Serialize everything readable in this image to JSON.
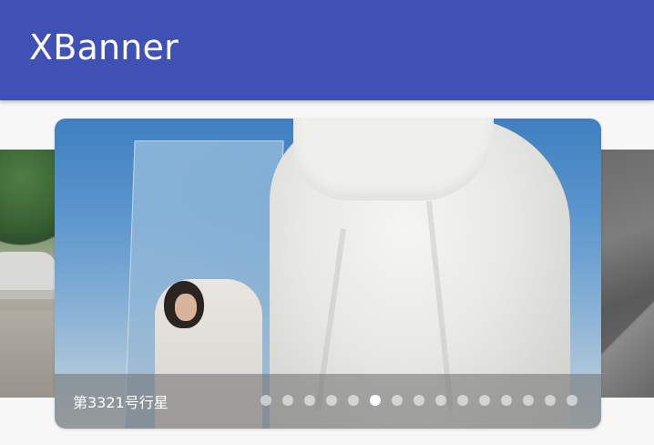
{
  "app": {
    "title": "XBanner",
    "accent_color": "#3f51b5"
  },
  "banner": {
    "caption": "第3321号行星",
    "indicator": {
      "count": 15,
      "active_index": 5
    }
  }
}
